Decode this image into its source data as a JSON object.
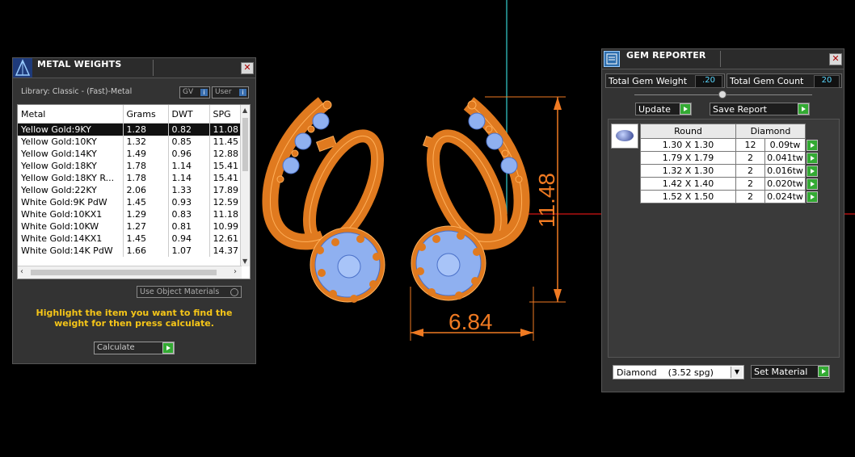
{
  "metal_weights": {
    "title": "METAL WEIGHTS",
    "library": "Library: Classic - (Fast)-Metal",
    "gv_label": "GV",
    "user_label": "User",
    "columns": [
      "Metal",
      "Grams",
      "DWT",
      "SPG"
    ],
    "rows": [
      [
        "Yellow Gold:9KY",
        "1.28",
        "0.82",
        "11.08"
      ],
      [
        "Yellow Gold:10KY",
        "1.32",
        "0.85",
        "11.45"
      ],
      [
        "Yellow Gold:14KY",
        "1.49",
        "0.96",
        "12.88"
      ],
      [
        "Yellow Gold:18KY",
        "1.78",
        "1.14",
        "15.41"
      ],
      [
        "Yellow Gold:18KY R...",
        "1.78",
        "1.14",
        "15.41"
      ],
      [
        "Yellow Gold:22KY",
        "2.06",
        "1.33",
        "17.89"
      ],
      [
        "White Gold:9K PdW",
        "1.45",
        "0.93",
        "12.59"
      ],
      [
        "White Gold:10KX1",
        "1.29",
        "0.83",
        "11.18"
      ],
      [
        "White Gold:10KW",
        "1.27",
        "0.81",
        "10.99"
      ],
      [
        "White Gold:14KX1",
        "1.45",
        "0.94",
        "12.61"
      ],
      [
        "White Gold:14K PdW",
        "1.66",
        "1.07",
        "14.37"
      ]
    ],
    "use_object_materials": "Use Object Materials",
    "instruction": "Highlight the item you want to find the weight for then press calculate.",
    "calculate_label": "Calculate"
  },
  "viewport": {
    "dimension_height": "11.48",
    "dimension_width": "6.84",
    "colors": {
      "metal": "#e07a1f",
      "stone": "#8fb0f0",
      "dimension": "#f07a22",
      "axis_v": "#2aa8a8",
      "axis_h": "#b01010"
    }
  },
  "gem_reporter": {
    "title": "GEM REPORTER",
    "total_weight_label": "Total Gem Weight",
    "total_weight_value": ".20",
    "total_count_label": "Total Gem Count",
    "total_count_value": "20",
    "update_label": "Update",
    "save_report_label": "Save Report",
    "shape_header": "Round",
    "material_header": "Diamond",
    "rows": [
      [
        "1.30 X 1.30",
        "12",
        "0.09tw"
      ],
      [
        "1.79 X 1.79",
        "2",
        "0.041tw"
      ],
      [
        "1.32 X 1.30",
        "2",
        "0.016tw"
      ],
      [
        "1.42 X 1.40",
        "2",
        "0.020tw"
      ],
      [
        "1.52 X 1.50",
        "2",
        "0.024tw"
      ]
    ],
    "material_select": "Diamond    (3.52 spg)",
    "set_material_label": "Set Material"
  }
}
